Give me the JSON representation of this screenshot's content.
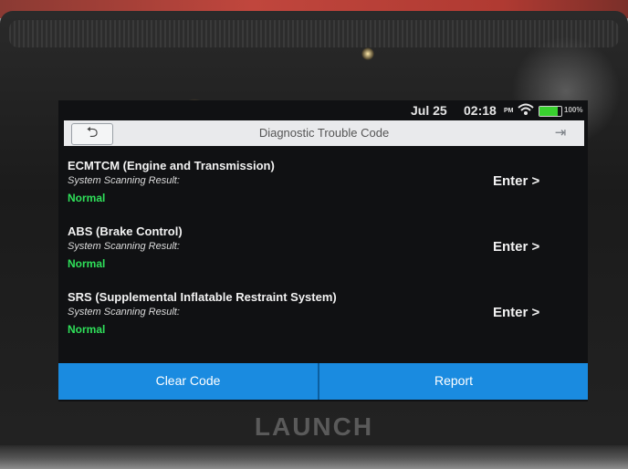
{
  "status": {
    "date": "Jul 25",
    "time": "02:18",
    "ampm": "PM",
    "battery_text": "100%",
    "battery_level": 0.85,
    "wifi_icon": "wifi-icon"
  },
  "header": {
    "title": "Diagnostic Trouble Code",
    "back_icon": "back-arrow-icon",
    "exit_icon": "exit-icon"
  },
  "systems": [
    {
      "name": "ECMTCM (Engine and Transmission)",
      "subtitle": "System Scanning Result:",
      "status": "Normal",
      "action": "Enter >"
    },
    {
      "name": "ABS (Brake Control)",
      "subtitle": "System Scanning Result:",
      "status": "Normal",
      "action": "Enter >"
    },
    {
      "name": "SRS (Supplemental Inflatable Restraint System)",
      "subtitle": "System Scanning Result:",
      "status": "Normal",
      "action": "Enter >"
    }
  ],
  "footer": {
    "clear_label": "Clear Code",
    "report_label": "Report"
  },
  "device": {
    "brand": "LAUNCH"
  },
  "colors": {
    "accent": "#1a8be0",
    "status_ok": "#2fe05a"
  }
}
